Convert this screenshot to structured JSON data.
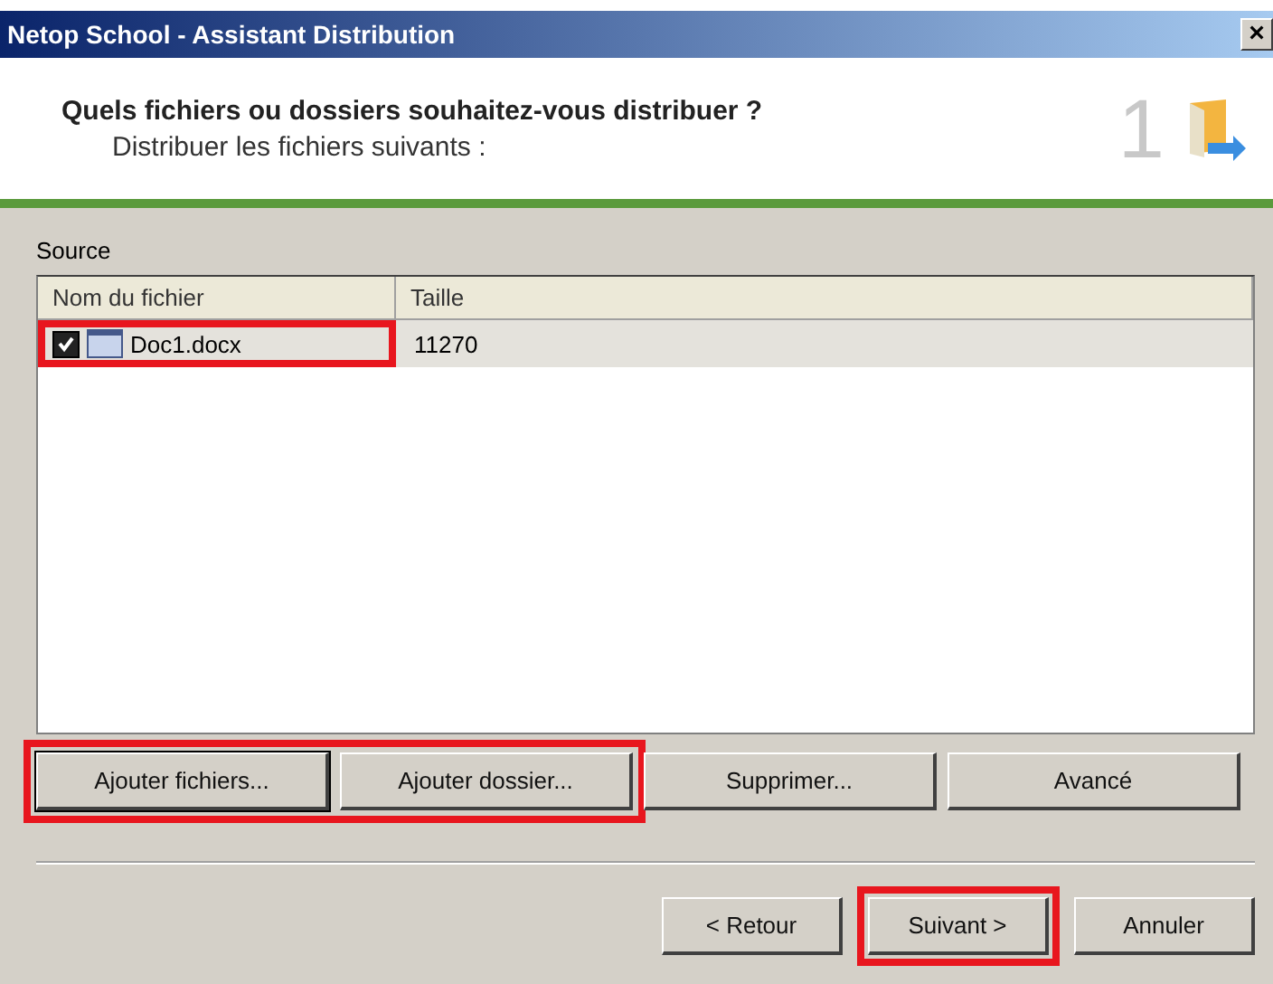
{
  "window": {
    "title": "Netop School - Assistant Distribution",
    "close": "×"
  },
  "header": {
    "heading": "Quels fichiers ou dossiers souhaitez-vous distribuer ?",
    "subheading": "Distribuer les fichiers suivants :",
    "step": "1"
  },
  "source": {
    "label": "Source",
    "columns": [
      "Nom du fichier",
      "Taille"
    ],
    "rows": [
      {
        "name": "Doc1.docx",
        "size": "11270",
        "checked": true,
        "selected": true,
        "highlighted": true
      }
    ]
  },
  "action_buttons": [
    {
      "label": "Ajouter fichiers...",
      "highlighted": true,
      "default": true
    },
    {
      "label": "Ajouter dossier...",
      "highlighted": true,
      "default": false
    },
    {
      "label": "Supprimer...",
      "highlighted": false,
      "default": false
    },
    {
      "label": "Avancé",
      "highlighted": false,
      "default": false
    }
  ],
  "nav_buttons": [
    {
      "label": "< Retour",
      "highlighted": false
    },
    {
      "label": "Suivant >",
      "highlighted": true
    },
    {
      "label": "Annuler",
      "highlighted": false
    }
  ]
}
